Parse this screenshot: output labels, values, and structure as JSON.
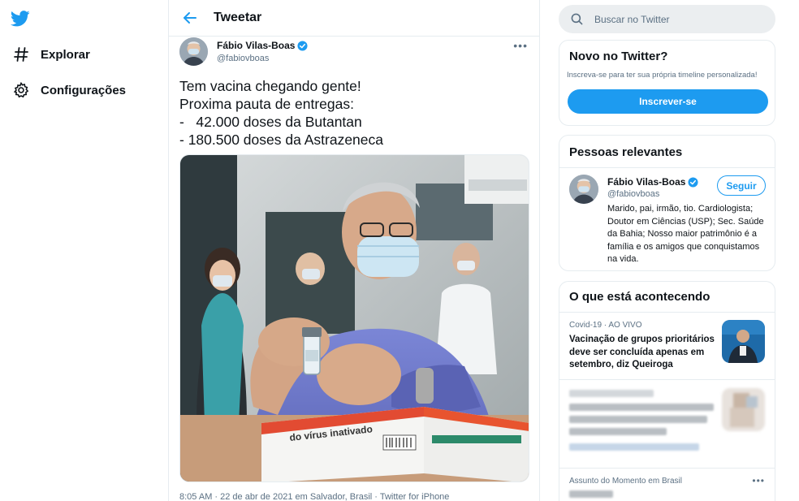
{
  "nav": {
    "logo_icon": "twitter-bird-icon",
    "items": [
      {
        "label": "Explorar",
        "icon": "hashtag-icon"
      },
      {
        "label": "Configurações",
        "icon": "gear-icon"
      }
    ]
  },
  "main": {
    "header_title": "Tweetar",
    "tweet": {
      "author_name": "Fábio Vilas-Boas",
      "author_handle": "@fabiovboas",
      "lines": [
        "Tem vacina chegando gente!",
        "Proxima pauta de entregas:",
        "-   42.000 doses da Butantan",
        "- 180.500 doses da Astrazeneca"
      ],
      "meta": "8:05 AM · 22 de abr de 2021 em Salvador, Brasil · Twitter for iPhone",
      "box_text": "do vírus inativado"
    }
  },
  "right": {
    "search_placeholder": "Buscar no Twitter",
    "signup": {
      "title": "Novo no Twitter?",
      "description": "Inscreva-se para ter sua própria timeline personalizada!",
      "button": "Inscrever-se"
    },
    "relevant": {
      "title": "Pessoas relevantes",
      "name": "Fábio Vilas-Boas",
      "handle": "@fabiovboas",
      "follow": "Seguir",
      "bio": "Marido, pai, irmão, tio. Cardiologista; Doutor em Ciências (USP); Sec. Saúde da Bahia; Nosso maior patrimônio é a família e os amigos que conquistamos na vida."
    },
    "trends": {
      "title": "O que está acontecendo",
      "first_category": "Covid-19 · AO VIVO",
      "first_title": "Vacinação de grupos prioritários deve ser concluída apenas em setembro, diz Queiroga",
      "last_category": "Assunto do Momento em Brasil"
    }
  },
  "colors": {
    "accent": "#1d9bf0",
    "text": "#0f1419",
    "muted": "#5b7083",
    "border": "#e6ecf0"
  }
}
